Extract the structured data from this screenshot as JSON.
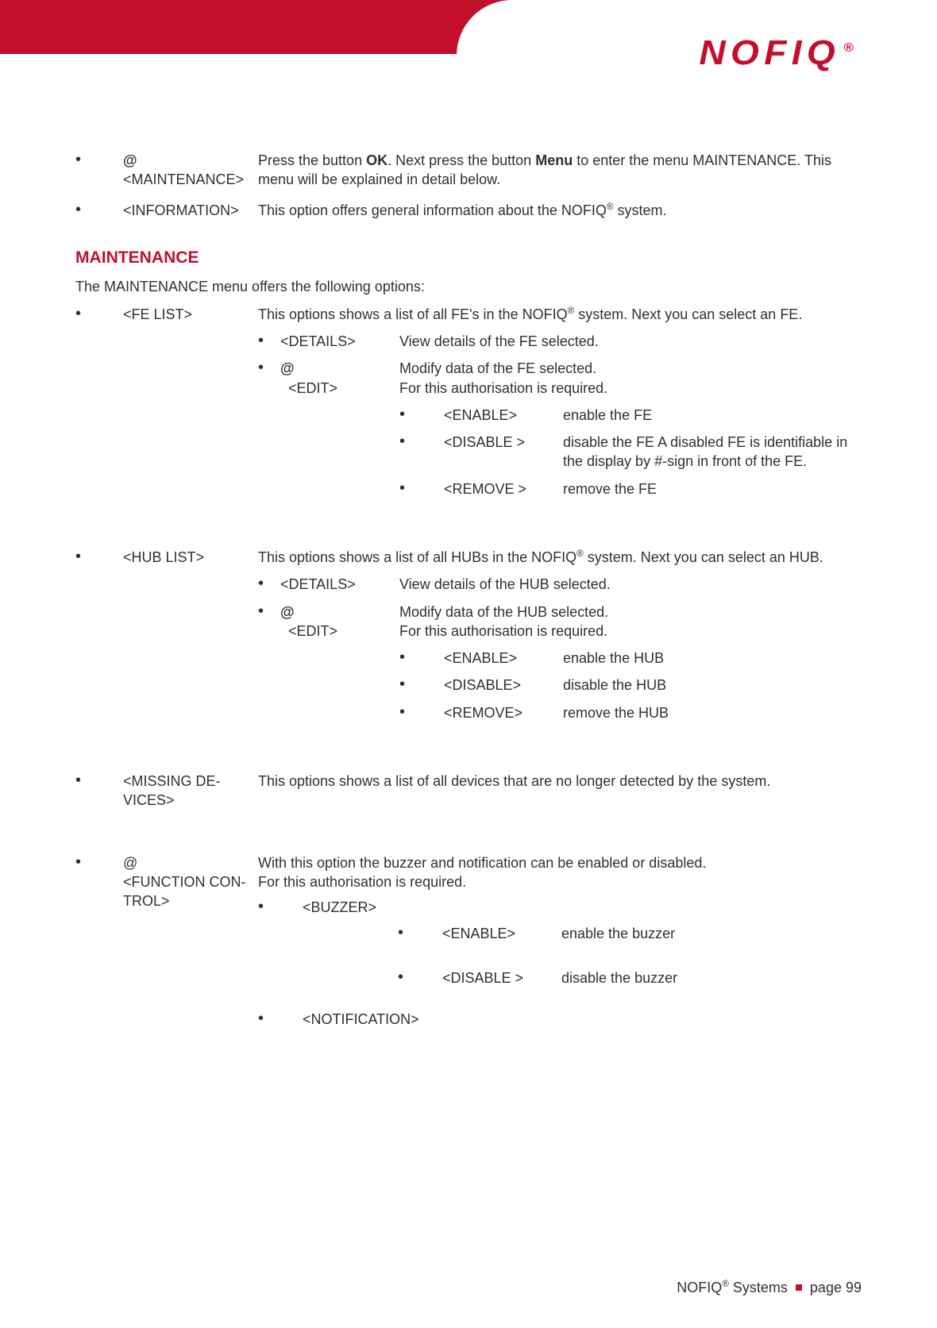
{
  "brand": "NOFIQ",
  "reg": "®",
  "top": [
    {
      "at": "@",
      "label": "<MAINTENANCE>",
      "desc_pre": "Press the button ",
      "ok": "OK",
      "desc_mid": ". Next press the button ",
      "menu": "Menu",
      "desc_post": " to enter the menu MAINTENANCE. This menu will be explained in detail below."
    },
    {
      "label": "<INFORMATION>",
      "desc_pre": "This option offers general information about the NOFIQ",
      "desc_post": " system."
    }
  ],
  "section": {
    "title": "MAINTENANCE",
    "intro": "The MAINTENANCE menu offers the following options:",
    "items": [
      {
        "label": "<FE LIST>",
        "desc_pre": "This options shows a list of all FE's in the NOFIQ",
        "desc_post": " system. Next you can select an FE.",
        "sub": [
          {
            "label": "<DETAILS>",
            "desc": "View details of the FE selected."
          },
          {
            "at": "@",
            "label": "<EDIT>",
            "desc_l1": "Modify data of the FE selected.",
            "desc_l2": "For this authorisation is required.",
            "sub": [
              {
                "label": "<ENABLE>",
                "desc": "enable the FE"
              },
              {
                "label": "<DISABLE >",
                "desc": "disable the FE A disabled FE is identifiable in the display by #-sign in front of the FE."
              },
              {
                "label": "<REMOVE >",
                "desc": "remove the FE"
              }
            ]
          }
        ]
      },
      {
        "label": "<HUB LIST>",
        "desc_pre": "This options shows a list of all HUBs in the NOFIQ",
        "desc_post": " system. Next you can select an HUB.",
        "sub": [
          {
            "label": "<DETAILS>",
            "desc": "View details of the HUB selected."
          },
          {
            "at": "@",
            "label": "<EDIT>",
            "desc_l1": "Modify data of the HUB selected.",
            "desc_l2": "For this authorisation is required.",
            "sub": [
              {
                "label": "<ENABLE>",
                "desc": "enable the HUB"
              },
              {
                "label": "<DISABLE>",
                "desc": "disable the HUB"
              },
              {
                "label": "<REMOVE>",
                "desc": "remove the HUB"
              }
            ]
          }
        ]
      },
      {
        "label": "<MISSING DE-VICES>",
        "desc": "This options shows a list of all devices that are no longer detected by the system."
      },
      {
        "at": "@",
        "label": "<FUNCTION CON-TROL>",
        "desc_l1": "With this option the buzzer and notification can be enabled or disabled.",
        "desc_l2": "For this authorisation is required.",
        "sub2": [
          {
            "label": "<BUZZER>",
            "sub": [
              {
                "label": "<ENABLE>",
                "desc": "enable the buzzer"
              },
              {
                "label": "<DISABLE >",
                "desc": "disable the buzzer"
              }
            ]
          },
          {
            "label": "<NOTIFICATION>"
          }
        ]
      }
    ]
  },
  "footer": {
    "brand": "NOFIQ",
    "reg": "®",
    "systems": " Systems",
    "page": "page 99"
  }
}
